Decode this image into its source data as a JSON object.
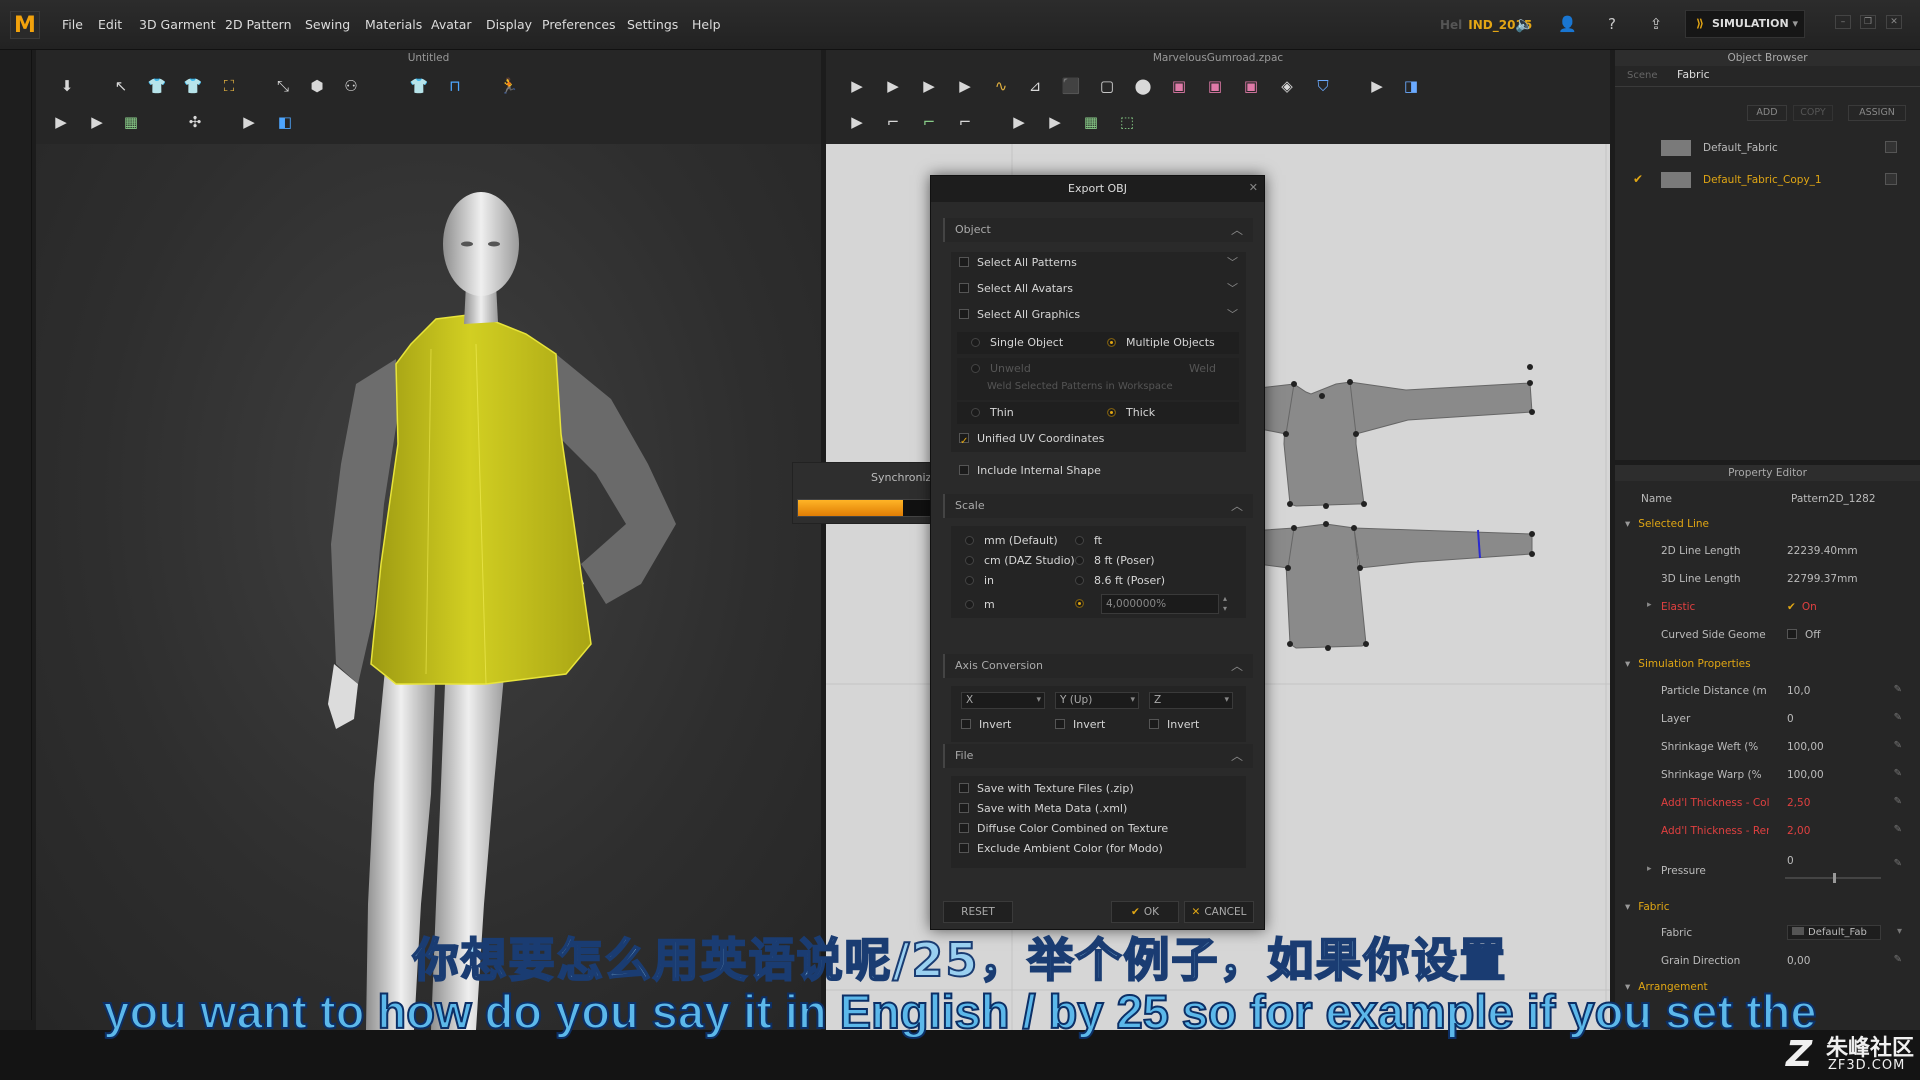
{
  "app": {
    "logo": "M"
  },
  "menu": [
    "File",
    "Edit",
    "3D Garment",
    "2D Pattern",
    "Sewing",
    "Materials",
    "Avatar",
    "Display",
    "Preferences",
    "Settings",
    "Help"
  ],
  "user": {
    "prefix": "Hel",
    "label": "IND_2015"
  },
  "mode": {
    "label": "SIMULATION"
  },
  "panel3d": {
    "title": "Untitled"
  },
  "panel2d": {
    "title": "MarvelousGumroad.zpac"
  },
  "sync": {
    "label": "Synchroniza",
    "progress": 0.78
  },
  "object_browser": {
    "title": "Object Browser",
    "tabs": [
      "Scene",
      "Fabric"
    ],
    "buttons": [
      "ADD",
      "COPY",
      "ASSIGN"
    ],
    "fabrics": [
      {
        "name": "Default_Fabric",
        "selected": false
      },
      {
        "name": "Default_Fabric_Copy_1",
        "selected": true
      }
    ]
  },
  "property_editor": {
    "title": "Property Editor",
    "name_key": "Name",
    "name_value": "Pattern2D_1282",
    "selected_line": "Selected Line",
    "line2d_k": "2D Line Length",
    "line2d_v": "22239.40mm",
    "line3d_k": "3D Line Length",
    "line3d_v": "22799.37mm",
    "elastic_k": "Elastic",
    "elastic_v": "On",
    "curved_k": "Curved Side Geome",
    "curved_v": "Off",
    "sim_props": "Simulation Properties",
    "particle_k": "Particle Distance (m",
    "particle_v": "10,0",
    "layer_k": "Layer",
    "layer_v": "0",
    "weft_k": "Shrinkage Weft (%",
    "weft_v": "100,00",
    "warp_k": "Shrinkage Warp (%",
    "warp_v": "100,00",
    "collision_k": "Add'l Thickness - Collisio",
    "collision_v": "2,50",
    "render_k": "Add'l Thickness - Renderi",
    "render_v": "2,00",
    "pressure_k": "Pressure",
    "pressure_v": "0",
    "fabric_sec": "Fabric",
    "fabric_k": "Fabric",
    "fabric_v": "Default_Fab",
    "grain_k": "Grain Direction",
    "grain_v": "0,00",
    "arrangement": "Arrangement"
  },
  "dialog": {
    "title": "Export OBJ",
    "object": {
      "header": "Object",
      "select_patterns": "Select All Patterns",
      "select_avatars": "Select All Avatars",
      "select_graphics": "Select All Graphics",
      "single": "Single Object",
      "multiple": "Multiple Objects",
      "unweld": "Unweld",
      "weld": "Weld",
      "weld_selected": "Weld Selected Patterns in Workspace",
      "thin": "Thin",
      "thick": "Thick",
      "unified_uv": "Unified UV Coordinates",
      "internal_shape": "Include Internal Shape"
    },
    "scale": {
      "header": "Scale",
      "mm": "mm (Default)",
      "ft": "ft",
      "cm": "cm (DAZ Studio)",
      "ft8": "8 ft (Poser)",
      "in": "in",
      "ft86": "8.6 ft (Poser)",
      "m": "m",
      "custom_value": "4,000000%"
    },
    "axis": {
      "header": "Axis Conversion",
      "x": "X",
      "y": "Y (Up)",
      "z": "Z",
      "invert": "Invert"
    },
    "file": {
      "header": "File",
      "texture": "Save with Texture Files (.zip)",
      "meta": "Save with Meta Data (.xml)",
      "diffuse": "Diffuse Color Combined on Texture",
      "ambient": "Exclude Ambient Color (for Modo)"
    },
    "buttons": {
      "reset": "RESET",
      "ok": "OK",
      "cancel": "CANCEL"
    }
  },
  "subtitles": {
    "cn": "你想要怎么用英语说呢/25，举个例子，如果你设置",
    "en": "you want to how do you say it in English / by 25 so for example if you set the"
  },
  "watermark": {
    "zh": "朱峰社区",
    "en": "ZF3D.COM"
  },
  "colors": {
    "accent": "#e0a614",
    "garment": "#c8c41a",
    "progress": "#f59a10",
    "red_prop": "#e04040"
  }
}
